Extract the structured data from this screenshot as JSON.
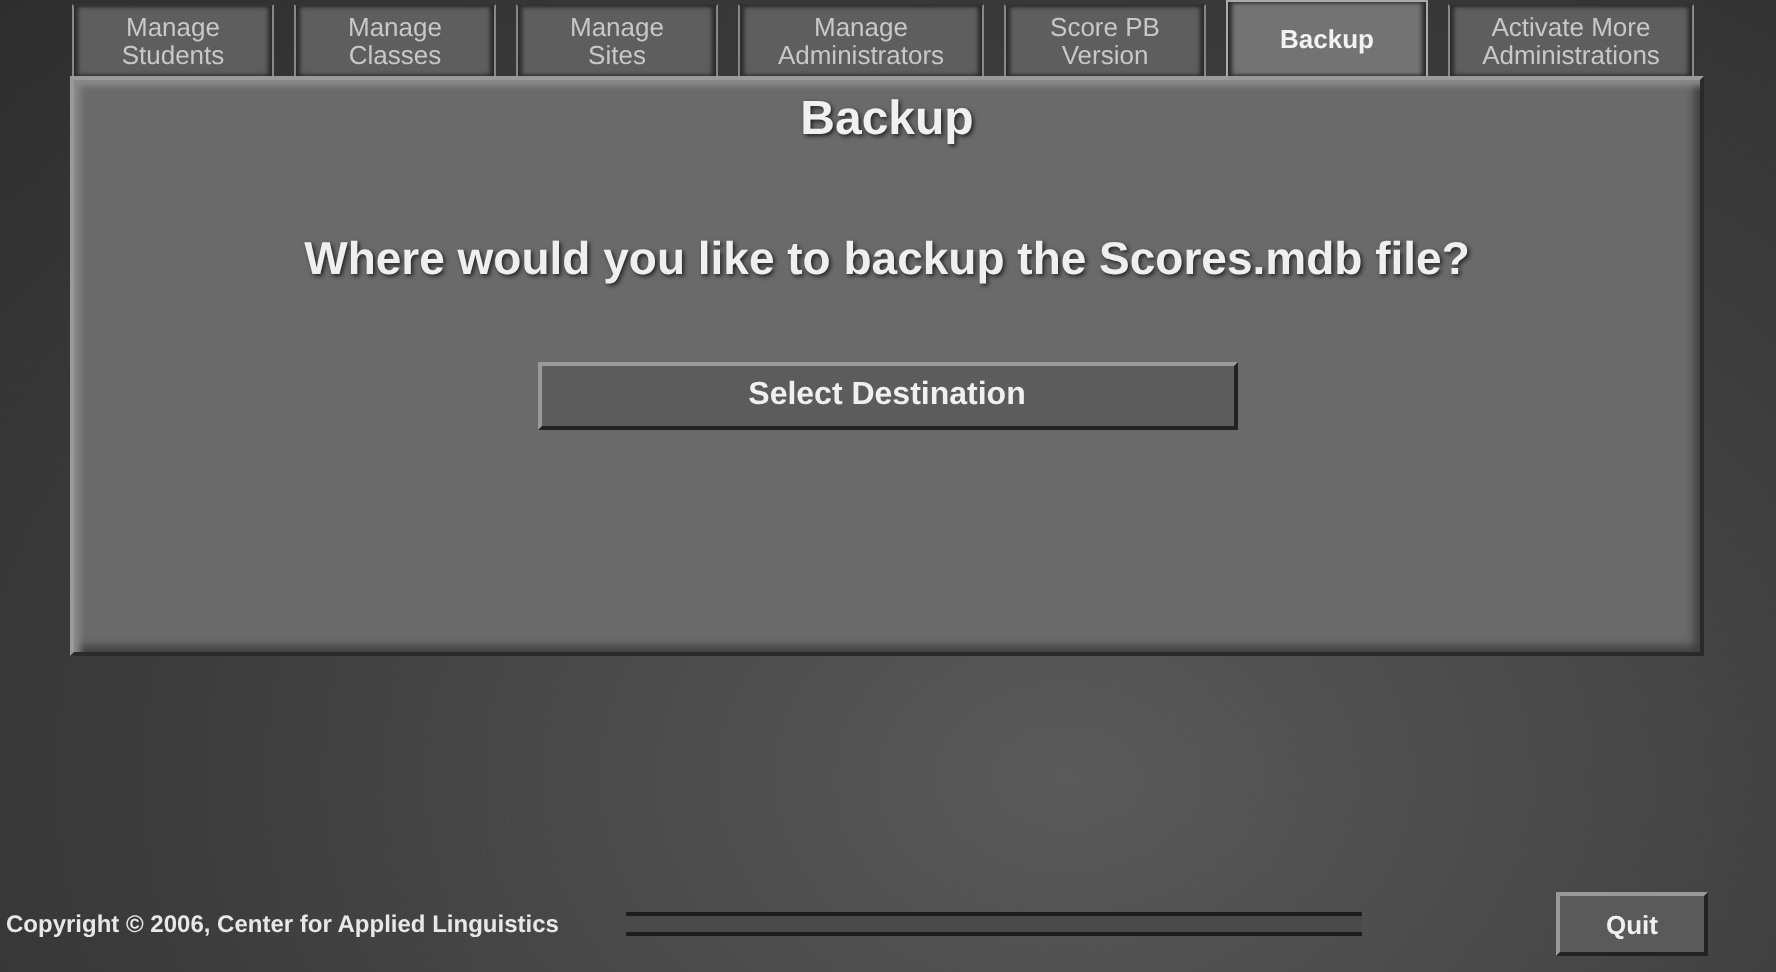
{
  "tabs": [
    {
      "label": "Manage Students",
      "selected": false
    },
    {
      "label": "Manage Classes",
      "selected": false
    },
    {
      "label": "Manage Sites",
      "selected": false
    },
    {
      "label": "Manage Administrators",
      "selected": false
    },
    {
      "label": "Score PB Version",
      "selected": false
    },
    {
      "label": "Backup",
      "selected": true
    },
    {
      "label": "Activate More Administrations",
      "selected": false
    }
  ],
  "panel": {
    "title": "Backup",
    "question": "Where would you like to backup the Scores.mdb file?",
    "button": "Select Destination"
  },
  "footer": {
    "copyright": "Copyright © 2006, Center for Applied Linguistics",
    "quit": "Quit"
  }
}
